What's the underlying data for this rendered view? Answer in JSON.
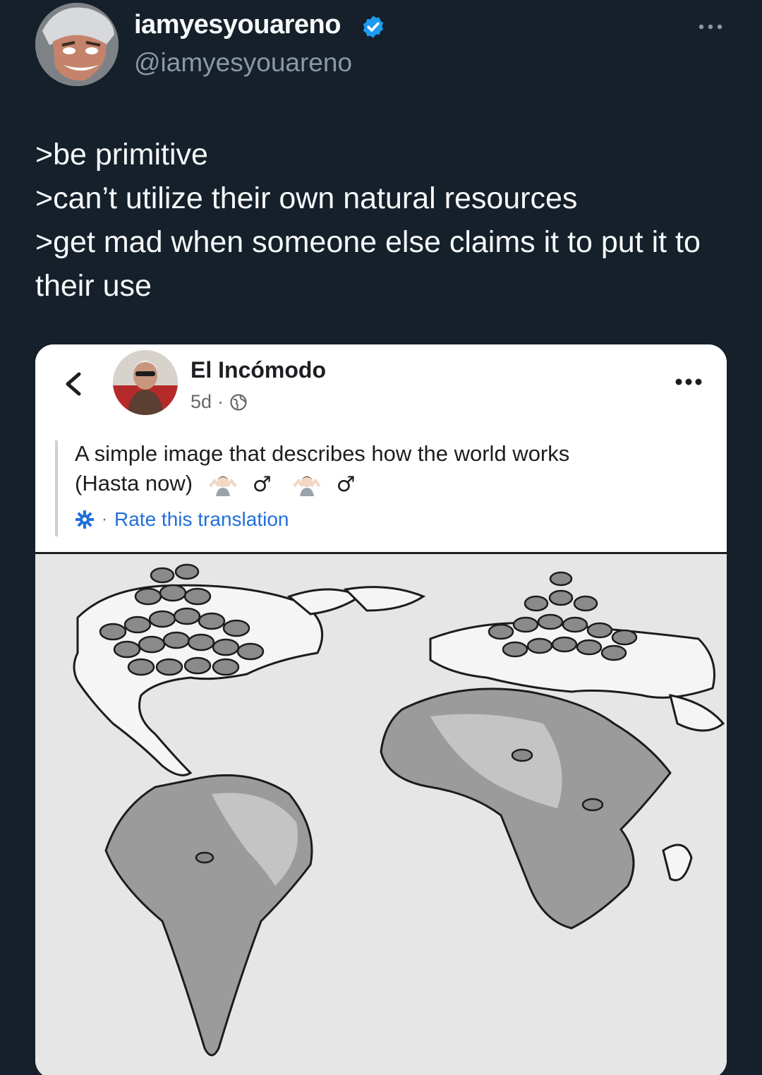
{
  "tweet": {
    "author": {
      "display_name": "iamyesyouareno",
      "handle": "@iamyesyouareno",
      "verified": true,
      "avatar_icon": "cartoon-face-avatar"
    },
    "lines": [
      ">be primitive",
      ">can’t utilize their own natural resources",
      ">get mad when someone else claims it to put it to their use"
    ],
    "colors": {
      "background": "#15202b",
      "text": "#f7f9f9",
      "secondary": "#8b98a5",
      "verified": "#1d9bf0"
    }
  },
  "embedded_post": {
    "page_name": "El Incómodo",
    "age": "5d",
    "separator": "·",
    "audience_icon": "globe-icon",
    "text_line1": "A simple image that describes how the world works",
    "text_line2": "(Hasta now)",
    "emoji_suffix": [
      "man-shrugging-icon",
      "♂",
      "man-shrugging-icon",
      "♂"
    ],
    "male_sign": "♂",
    "translation_dot": "·",
    "translation_link": "Rate this translation",
    "image_icon": "world-map-cartoon-illustration",
    "colors": {
      "link": "#216fdb",
      "text": "#1c1e21",
      "meta": "#65676b"
    }
  }
}
